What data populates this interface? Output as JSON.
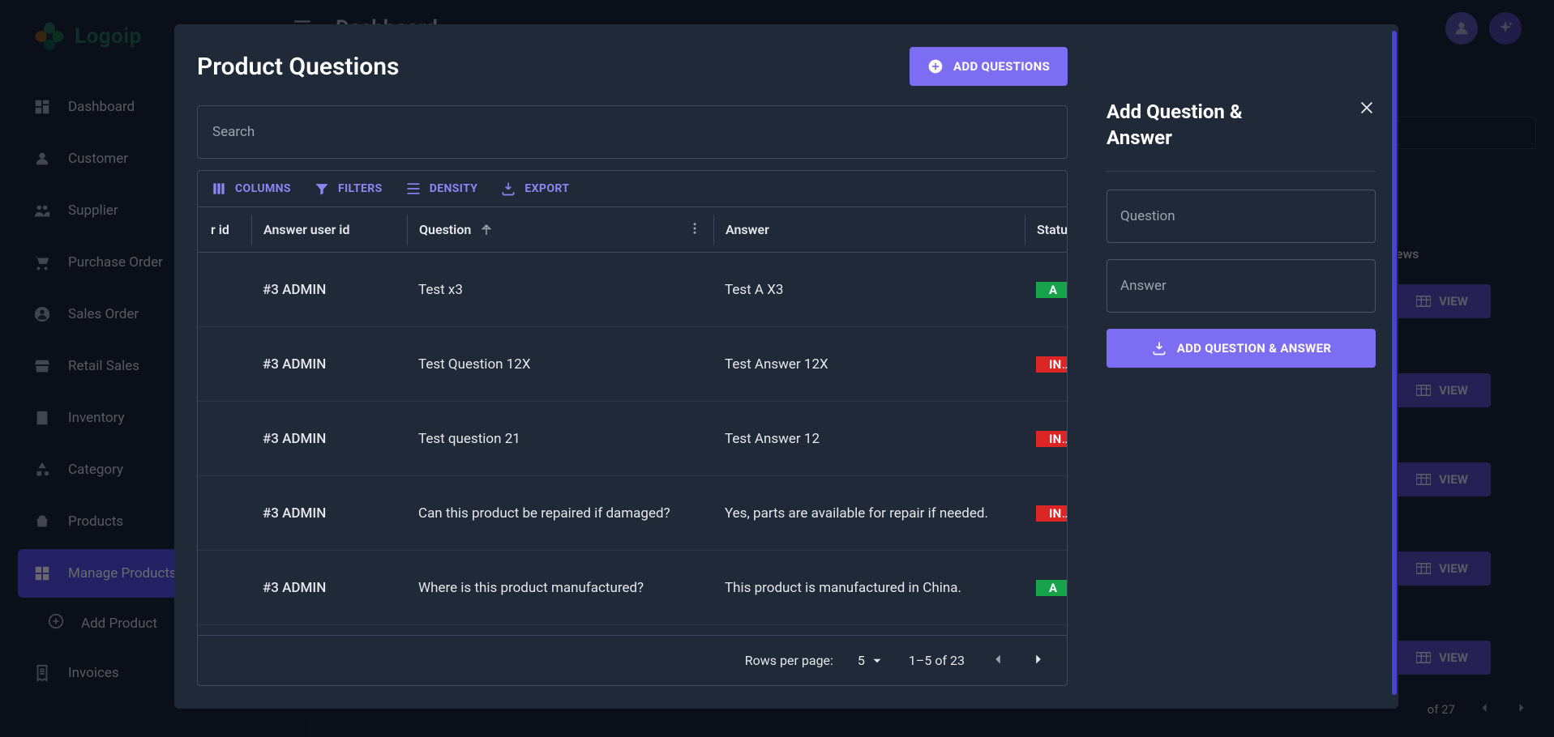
{
  "logo": {
    "text": "Logoip"
  },
  "topbar": {
    "title": "Dashboard"
  },
  "sidebar": {
    "items": [
      {
        "label": "Dashboard"
      },
      {
        "label": "Customer"
      },
      {
        "label": "Supplier"
      },
      {
        "label": "Purchase Order"
      },
      {
        "label": "Sales Order"
      },
      {
        "label": "Retail Sales"
      },
      {
        "label": "Inventory"
      },
      {
        "label": "Category"
      },
      {
        "label": "Products"
      },
      {
        "label": "Manage Products"
      },
      {
        "label": "Add Product"
      },
      {
        "label": "Invoices"
      }
    ]
  },
  "bg": {
    "reviews_header": "Reviews",
    "view": "VIEW",
    "pagination": "of 27"
  },
  "modal": {
    "title": "Product Questions",
    "add_btn": "ADD QUESTIONS",
    "search_placeholder": "Search",
    "toolbar": {
      "columns": "COLUMNS",
      "filters": "FILTERS",
      "density": "DENSITY",
      "export": "EXPORT"
    },
    "headers": {
      "qid": "r id",
      "auid": "Answer user id",
      "question": "Question",
      "answer": "Answer",
      "status": "Status"
    },
    "rows": [
      {
        "auid": "#3 ADMIN",
        "q": "Test x3",
        "a": "Test A X3",
        "status": "ACTIVE",
        "status_color": "green"
      },
      {
        "auid": "#3 ADMIN",
        "q": "Test Question 12X",
        "a": "Test Answer 12X",
        "status": "INACTIVE",
        "status_color": "red"
      },
      {
        "auid": "#3 ADMIN",
        "q": "Test question 21",
        "a": "Test Answer 12",
        "status": "INACTIVE",
        "status_color": "red"
      },
      {
        "auid": "#3 ADMIN",
        "q": "Can this product be repaired if damaged?",
        "a": "Yes, parts are available for repair if needed.",
        "status": "INACTIVE",
        "status_color": "red"
      },
      {
        "auid": "#3 ADMIN",
        "q": "Where is this product manufactured?",
        "a": "This product is manufactured in China.",
        "status": "ACTIVE",
        "status_color": "green"
      }
    ],
    "footer": {
      "rpp_label": "Rows per page:",
      "rpp_value": "5",
      "range": "1–5 of 23"
    },
    "panel": {
      "title": "Add Question & Answer",
      "question_label": "Question",
      "answer_label": "Answer",
      "submit": "ADD QUESTION & ANSWER"
    }
  }
}
